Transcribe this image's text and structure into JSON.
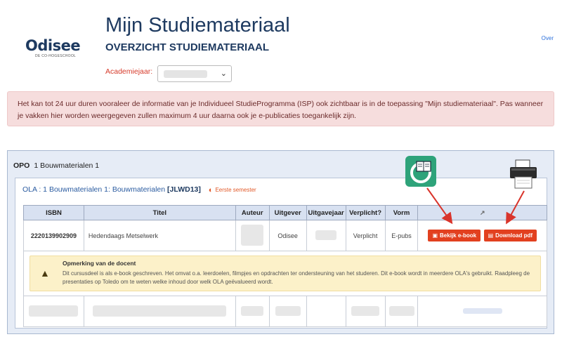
{
  "logo": {
    "word": "Odisee",
    "sub": "DE CO-HOGESCHOOL"
  },
  "header": {
    "title": "Mijn Studiemateriaal",
    "subtitle": "OVERZICHT STUDIEMATERIAAL",
    "overview_link": "Over"
  },
  "academic_year": {
    "label": "Academiejaar:"
  },
  "alert": {
    "text": "Het kan tot 24 uur duren vooraleer de informatie van je Individueel StudieProgramma (ISP) ook zichtbaar is in de toepassing \"Mijn studiemateriaal\". Pas wanneer je vakken hier worden weergegeven zullen maximum 4 uur daarna ook je e-publicaties toegankelijk zijn."
  },
  "opo": {
    "label": "OPO",
    "name": "1 Bouwmaterialen 1"
  },
  "ola": {
    "prefix": "OLA : 1 Bouwmaterialen 1: Bouwmaterialen",
    "code": "[JLWD13]",
    "semester": "Eerste semester"
  },
  "table": {
    "headers": [
      "ISBN",
      "Titel",
      "Auteur",
      "Uitgever",
      "Uitgavejaar",
      "Verplicht?",
      "Vorm"
    ],
    "row": {
      "isbn": "2220139902909",
      "title": "Hedendaags Metselwerk",
      "publisher": "Odisee",
      "required": "Verplicht",
      "form": "E-pubs"
    },
    "buttons": {
      "view_ebook": "Bekijk e-book",
      "download_pdf": "Download pdf"
    }
  },
  "note": {
    "title": "Opmerking van de docent",
    "body": "Dit cursusdeel is als e-book geschreven. Het omvat o.a. leerdoelen, filmpjes en opdrachten ter ondersteuning van het studeren. Dit e-book wordt in meerdere OLA's gebruikt. Raadpleeg de presentaties op Toledo om te weten welke inhoud door welk OLA geëvalueerd wordt."
  },
  "icons": {
    "ebook_app": "ebook-reader-app-icon",
    "printer": "printer-icon",
    "external_link": "external-link-icon",
    "teacher": "graduation-cap-icon"
  },
  "colors": {
    "brand_navy": "#1e3a60",
    "button_red": "#e2401f",
    "alert_bg": "#f6dddd",
    "note_bg": "#fcf1c9"
  }
}
